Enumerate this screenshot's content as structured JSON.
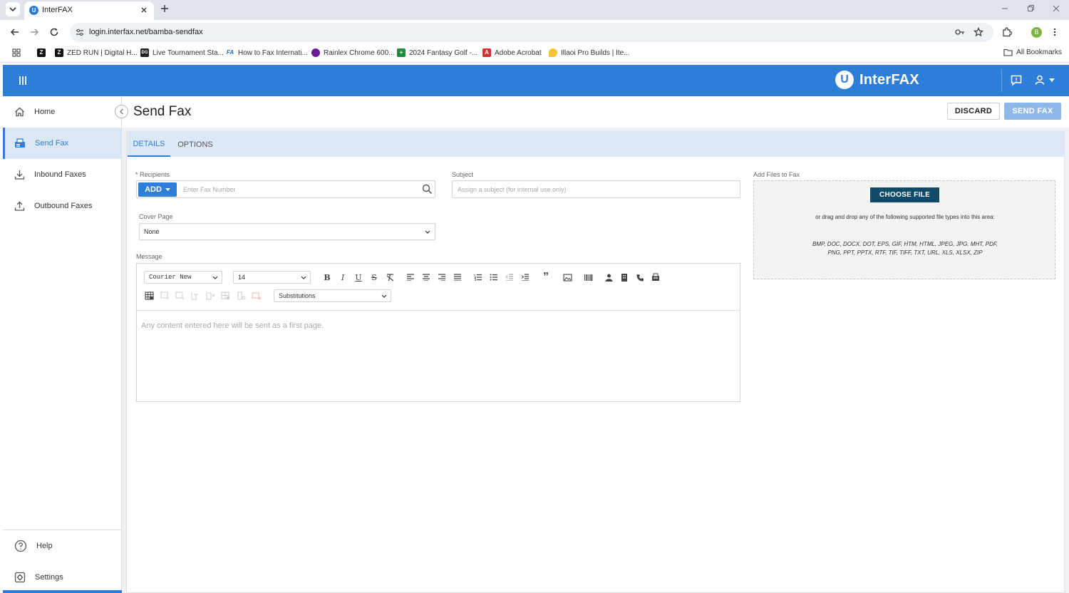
{
  "browser": {
    "tab_title": "InterFAX",
    "url": "login.interfax.net/bamba-sendfax",
    "profile_initial": "B",
    "bookmarks": [
      {
        "label": "",
        "icon": "Z"
      },
      {
        "label": "ZED RUN | Digital H...",
        "icon": "Z"
      },
      {
        "label": "Live Tournament Sta...",
        "icon": "DG"
      },
      {
        "label": "How to Fax Internati...",
        "icon": "FA"
      },
      {
        "label": "Rainlex Chrome 600...",
        "icon": "R"
      },
      {
        "label": "2024 Fantasy Golf -...",
        "icon": "+"
      },
      {
        "label": "Adobe Acrobat",
        "icon": "A"
      },
      {
        "label": "Illaoi Pro Builds | Ite...",
        "icon": "I"
      }
    ],
    "all_bookmarks": "All Bookmarks"
  },
  "app": {
    "brand": "InterFAX",
    "logo_letter": "U"
  },
  "sidebar": {
    "items": [
      {
        "label": "Home",
        "icon": "home-icon"
      },
      {
        "label": "Send Fax",
        "icon": "fax-icon",
        "active": true
      },
      {
        "label": "Inbound Faxes",
        "icon": "download-icon"
      },
      {
        "label": "Outbound Faxes",
        "icon": "upload-icon"
      }
    ],
    "bottom": [
      {
        "label": "Help",
        "icon": "help-icon"
      },
      {
        "label": "Settings",
        "icon": "settings-icon"
      }
    ]
  },
  "page": {
    "title": "Send Fax",
    "discard": "DISCARD",
    "send": "SEND FAX"
  },
  "tabs": [
    "DETAILS",
    "OPTIONS"
  ],
  "form": {
    "recipients_label": "* Recipients",
    "add_label": "ADD",
    "fax_placeholder": "Enter Fax Number",
    "subject_label": "Subject",
    "subject_placeholder": "Assign a subject (for internal use only)",
    "cover_label": "Cover Page",
    "cover_value": "None",
    "message_label": "Message",
    "files_label": "Add Files to Fax",
    "choose_file": "CHOOSE FILE",
    "drop_text": "or drag and drop any of the following supported file types into this area:",
    "file_types": "BMP, DOC, DOCX, DOT, EPS, GIF, HTM, HTML, JPEG, JPG, MHT, PDF, PNG, PPT, PPTX, RTF, TIF, TIFF, TXT, URL, XLS, XLSX, ZIP"
  },
  "editor": {
    "font": "Courier New",
    "size": "14",
    "substitutions": "Substitutions",
    "body_placeholder": "Any content entered here will be sent as a first page."
  },
  "colors": {
    "primary": "#2d7ed8",
    "choose_file_bg": "#124b6a",
    "send_disabled": "#8db8e8"
  }
}
